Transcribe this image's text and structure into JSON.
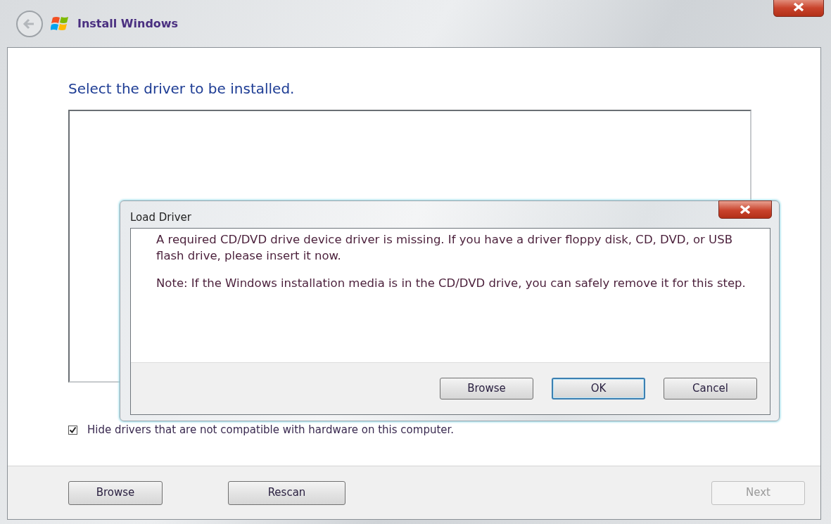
{
  "window": {
    "title": "Install Windows"
  },
  "heading": "Select the driver to be installed.",
  "hide_incompatible": {
    "label": "Hide drivers that are not compatible with hardware on this computer.",
    "checked": true
  },
  "buttons": [
    {
      "label": "Browse",
      "disabled": false
    },
    {
      "label": "Rescan",
      "disabled": false
    },
    {
      "label": "Next",
      "disabled": true
    }
  ],
  "dialog": {
    "title": "Load Driver",
    "paragraphs": [
      "A required CD/DVD drive device driver is missing. If you have a driver floppy disk, CD, DVD, or USB flash drive, please insert it now.",
      "Note: If the Windows installation media is in the CD/DVD drive, you can safely remove it for this step."
    ],
    "buttons": [
      {
        "label": "Browse",
        "default": false
      },
      {
        "label": "OK",
        "default": true
      },
      {
        "label": "Cancel",
        "default": false
      }
    ]
  }
}
